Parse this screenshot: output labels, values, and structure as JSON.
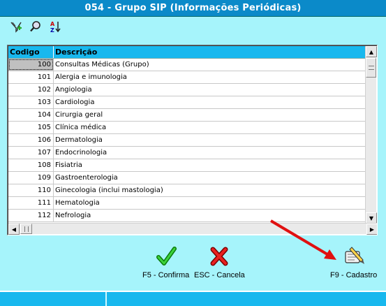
{
  "window": {
    "title": "054 - Grupo SIP (Informações Periódicas)"
  },
  "toolbar": {
    "icons": [
      "filter-add-icon",
      "search-icon",
      "sort-az-icon"
    ]
  },
  "grid": {
    "columns": {
      "code": "Codigo",
      "description": "Descrição"
    },
    "rows": [
      {
        "code": "100",
        "description": "Consultas Médicas (Grupo)"
      },
      {
        "code": "101",
        "description": "Alergia e imunologia"
      },
      {
        "code": "102",
        "description": "Angiologia"
      },
      {
        "code": "103",
        "description": "Cardiologia"
      },
      {
        "code": "104",
        "description": "Cirurgia geral"
      },
      {
        "code": "105",
        "description": "Clínica médica"
      },
      {
        "code": "106",
        "description": "Dermatologia"
      },
      {
        "code": "107",
        "description": "Endocrinologia"
      },
      {
        "code": "108",
        "description": "Fisiatria"
      },
      {
        "code": "109",
        "description": "Gastroenterologia"
      },
      {
        "code": "110",
        "description": "Ginecologia (inclui mastologia)"
      },
      {
        "code": "111",
        "description": "Hematologia"
      },
      {
        "code": "112",
        "description": "Nefrologia"
      }
    ],
    "selected_code": "100"
  },
  "actions": {
    "confirm": "F5 - Confirma",
    "cancel": "ESC - Cancela",
    "register": "F9 - Cadastro"
  },
  "colors": {
    "background": "#a6f4fb",
    "titlebar": "#0b8ac9",
    "header": "#18b8ee",
    "arrow": "#e01010"
  }
}
